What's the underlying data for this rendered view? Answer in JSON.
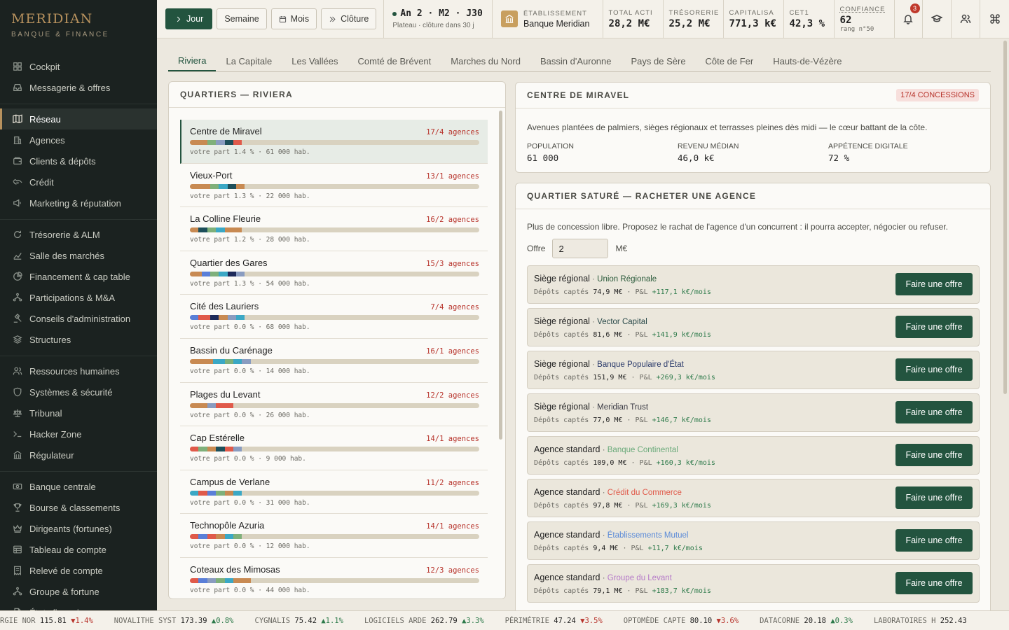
{
  "brand": {
    "name": "MERIDIAN",
    "sub": "BANQUE & FINANCE"
  },
  "nav_groups": [
    [
      {
        "label": "Cockpit",
        "icon": "grid-icon"
      },
      {
        "label": "Messagerie & offres",
        "icon": "inbox-icon"
      }
    ],
    [
      {
        "label": "Réseau",
        "icon": "map-icon",
        "active": true
      },
      {
        "label": "Agences",
        "icon": "building-icon"
      },
      {
        "label": "Clients & dépôts",
        "icon": "wallet-icon"
      },
      {
        "label": "Crédit",
        "icon": "handshake-icon"
      },
      {
        "label": "Marketing & réputation",
        "icon": "megaphone-icon"
      }
    ],
    [
      {
        "label": "Trésorerie & ALM",
        "icon": "refresh-icon"
      },
      {
        "label": "Salle des marchés",
        "icon": "chart-icon"
      },
      {
        "label": "Financement & cap table",
        "icon": "pie-icon"
      },
      {
        "label": "Participations & M&A",
        "icon": "network-icon"
      },
      {
        "label": "Conseils d'administration",
        "icon": "gavel-icon"
      },
      {
        "label": "Structures",
        "icon": "layers-icon"
      }
    ],
    [
      {
        "label": "Ressources humaines",
        "icon": "users-icon"
      },
      {
        "label": "Systèmes & sécurité",
        "icon": "shield-icon"
      },
      {
        "label": "Tribunal",
        "icon": "scale-icon"
      },
      {
        "label": "Hacker Zone",
        "icon": "terminal-icon"
      },
      {
        "label": "Régulateur",
        "icon": "bank-icon"
      }
    ],
    [
      {
        "label": "Banque centrale",
        "icon": "banknote-icon"
      },
      {
        "label": "Bourse & classements",
        "icon": "trophy-icon"
      },
      {
        "label": "Dirigeants (fortunes)",
        "icon": "crown-icon"
      },
      {
        "label": "Tableau de compte",
        "icon": "table-icon"
      },
      {
        "label": "Relevé de compte",
        "icon": "receipt-icon"
      },
      {
        "label": "Groupe & fortune",
        "icon": "network-icon"
      },
      {
        "label": "États financiers",
        "icon": "file-icon"
      }
    ]
  ],
  "topbar": {
    "buttons": [
      {
        "label": "Jour",
        "icon": "chevron-right-icon",
        "primary": true
      },
      {
        "label": "Semaine",
        "icon": ""
      },
      {
        "label": "Mois",
        "icon": "calendar-icon"
      },
      {
        "label": "Clôture",
        "icon": "double-chevron-icon"
      }
    ],
    "date": {
      "main": "An 2 · M2 · J30",
      "sub": "Plateau · clôture dans 30 j"
    },
    "etablissement": {
      "label": "ÉTABLISSEMENT",
      "value": "Banque Meridian"
    },
    "stats": [
      {
        "label": "TOTAL ACTI",
        "value": "28,2 M€",
        "sub": ""
      },
      {
        "label": "TRÉSORERIE",
        "value": "25,2 M€",
        "sub": ""
      },
      {
        "label": "CAPITALISA",
        "value": "771,3 k€",
        "sub": ""
      },
      {
        "label": "CET1",
        "value": "42,3 %",
        "sub": ""
      },
      {
        "label": "CONFIANCE",
        "value": "62",
        "sub": "rang n°50"
      }
    ],
    "notifications": "3"
  },
  "tabs": [
    "Riviera",
    "La Capitale",
    "Les Vallées",
    "Comté de Brévent",
    "Marches du Nord",
    "Bassin d'Auronne",
    "Pays de Sère",
    "Côte de Fer",
    "Hauts-de-Vézère"
  ],
  "quartiers": {
    "title": "QUARTIERS — RIVIERA",
    "items": [
      {
        "name": "Centre de Miravel",
        "agences": "17/4 agences",
        "meta": "votre part 1.4 % · 61 000 hab.",
        "bar": [
          [
            "#c88a52",
            6
          ],
          [
            "#7fb07a",
            3
          ],
          [
            "#8a9cc0",
            3
          ],
          [
            "#1d4f5a",
            3
          ],
          [
            "#e05a4a",
            3
          ]
        ]
      },
      {
        "name": "Vieux-Port",
        "agences": "13/1 agences",
        "meta": "votre part 1.3 % · 22 000 hab.",
        "bar": [
          [
            "#c88a52",
            7
          ],
          [
            "#7fb07a",
            3
          ],
          [
            "#3ba8c5",
            3
          ],
          [
            "#1d4f5a",
            3
          ],
          [
            "#c88a52",
            3
          ]
        ]
      },
      {
        "name": "La Colline Fleurie",
        "agences": "16/2 agences",
        "meta": "votre part 1.2 % · 28 000 hab.",
        "bar": [
          [
            "#c88a52",
            3
          ],
          [
            "#1d4f5a",
            3
          ],
          [
            "#7fb07a",
            3
          ],
          [
            "#3ba8c5",
            3
          ],
          [
            "#c88a52",
            6
          ]
        ]
      },
      {
        "name": "Quartier des Gares",
        "agences": "15/3 agences",
        "meta": "votre part 1.3 % · 54 000 hab.",
        "bar": [
          [
            "#c88a52",
            4
          ],
          [
            "#5a7fd8",
            3
          ],
          [
            "#7fb07a",
            3
          ],
          [
            "#3ba8c5",
            3
          ],
          [
            "#1d2a5a",
            3
          ],
          [
            "#8a9cc0",
            3
          ]
        ]
      },
      {
        "name": "Cité des Lauriers",
        "agences": "7/4 agences",
        "meta": "votre part 0.0 % · 68 000 hab.",
        "bar": [
          [
            "#5a7fd8",
            3
          ],
          [
            "#e05a4a",
            4
          ],
          [
            "#1d2a5a",
            3
          ],
          [
            "#c88a52",
            3
          ],
          [
            "#8a9cc0",
            3
          ],
          [
            "#3ba8c5",
            3
          ]
        ]
      },
      {
        "name": "Bassin du Carénage",
        "agences": "16/1 agences",
        "meta": "votre part 0.0 % · 14 000 hab.",
        "bar": [
          [
            "#c88a52",
            8
          ],
          [
            "#3ba8c5",
            4
          ],
          [
            "#7fb07a",
            3
          ],
          [
            "#3ba8c5",
            3
          ],
          [
            "#8a9cc0",
            3
          ]
        ]
      },
      {
        "name": "Plages du Levant",
        "agences": "12/2 agences",
        "meta": "votre part 0.0 % · 26 000 hab.",
        "bar": [
          [
            "#c88a52",
            3
          ],
          [
            "#c88a52",
            3
          ],
          [
            "#8a9cc0",
            3
          ],
          [
            "#e05a4a",
            3
          ],
          [
            "#e05a4a",
            3
          ]
        ]
      },
      {
        "name": "Cap Estérelle",
        "agences": "14/1 agences",
        "meta": "votre part 0.0 % · 9 000 hab.",
        "bar": [
          [
            "#e05a4a",
            3
          ],
          [
            "#7fb07a",
            3
          ],
          [
            "#c88a52",
            3
          ],
          [
            "#1d4f5a",
            3
          ],
          [
            "#e05a4a",
            3
          ],
          [
            "#8a9cc0",
            3
          ]
        ]
      },
      {
        "name": "Campus de Verlane",
        "agences": "11/2 agences",
        "meta": "votre part 0.0 % · 31 000 hab.",
        "bar": [
          [
            "#3ba8c5",
            3
          ],
          [
            "#e05a4a",
            3
          ],
          [
            "#5a7fd8",
            3
          ],
          [
            "#7fb07a",
            3
          ],
          [
            "#c88a52",
            3
          ],
          [
            "#3ba8c5",
            3
          ]
        ]
      },
      {
        "name": "Technopôle Azuria",
        "agences": "14/1 agences",
        "meta": "votre part 0.0 % · 12 000 hab.",
        "bar": [
          [
            "#e05a4a",
            3
          ],
          [
            "#5a7fd8",
            3
          ],
          [
            "#e05a4a",
            3
          ],
          [
            "#c88a52",
            3
          ],
          [
            "#3ba8c5",
            3
          ],
          [
            "#7fb07a",
            3
          ]
        ]
      },
      {
        "name": "Coteaux des Mimosas",
        "agences": "12/3 agences",
        "meta": "votre part 0.0 % · 44 000 hab.",
        "bar": [
          [
            "#e05a4a",
            3
          ],
          [
            "#5a7fd8",
            3
          ],
          [
            "#8a9cc0",
            3
          ],
          [
            "#7fb07a",
            3
          ],
          [
            "#3ba8c5",
            3
          ],
          [
            "#c88a52",
            6
          ]
        ]
      }
    ]
  },
  "detail": {
    "title": "CENTRE DE MIRAVEL",
    "badge": "17/4 CONCESSIONS",
    "description": "Avenues plantées de palmiers, sièges régionaux et terrasses pleines dès midi — le cœur battant de la côte.",
    "metrics": [
      {
        "label": "POPULATION",
        "value": "61 000"
      },
      {
        "label": "REVENU MÉDIAN",
        "value": "46,0 k€"
      },
      {
        "label": "APPÉTENCE DIGITALE",
        "value": "72 %"
      }
    ]
  },
  "offers": {
    "title": "QUARTIER SATURÉ — RACHETER UNE AGENCE",
    "intro": "Plus de concession libre. Proposez le rachat de l'agence d'un concurrent : il pourra accepter, négocier ou refuser.",
    "offer_label": "Offre",
    "offer_value": "2",
    "offer_unit": "M€",
    "button_label": "Faire une offre",
    "deposits_label": "Dépôts captés",
    "pl_label": "P&L",
    "cards": [
      {
        "type": "Siège régional",
        "owner": "Union Régionale",
        "color": "#2a5a3a",
        "deposits": "74,9 M€",
        "pl": "+117,1 k€/mois"
      },
      {
        "type": "Siège régional",
        "owner": "Vector Capital",
        "color": "#2a4a4a",
        "deposits": "81,6 M€",
        "pl": "+141,9 k€/mois"
      },
      {
        "type": "Siège régional",
        "owner": "Banque Populaire d'État",
        "color": "#2a3a6a",
        "deposits": "151,9 M€",
        "pl": "+269,3 k€/mois"
      },
      {
        "type": "Siège régional",
        "owner": "Meridian Trust",
        "color": "#3a3a44",
        "deposits": "77,0 M€",
        "pl": "+146,7 k€/mois"
      },
      {
        "type": "Agence standard",
        "owner": "Banque Continental",
        "color": "#6aaa7a",
        "deposits": "109,0 M€",
        "pl": "+160,3 k€/mois"
      },
      {
        "type": "Agence standard",
        "owner": "Crédit du Commerce",
        "color": "#e05a4a",
        "deposits": "97,8 M€",
        "pl": "+169,3 k€/mois"
      },
      {
        "type": "Agence standard",
        "owner": "Établissements Mutuel",
        "color": "#5a8ad8",
        "deposits": "9,4 M€",
        "pl": "+11,7 k€/mois"
      },
      {
        "type": "Agence standard",
        "owner": "Groupe du Levant",
        "color": "#b57ac8",
        "deposits": "79,1 M€",
        "pl": "+183,7 k€/mois"
      }
    ]
  },
  "ticker": [
    {
      "name": "RGIE NOR",
      "price": "115.81",
      "chg": "▼1.4%",
      "dir": "dn"
    },
    {
      "name": "NOVALITHE SYST",
      "price": "173.39",
      "chg": "▲0.8%",
      "dir": "up"
    },
    {
      "name": "CYGNALIS",
      "price": "75.42",
      "chg": "▲1.1%",
      "dir": "up"
    },
    {
      "name": "LOGICIELS ARDE",
      "price": "262.79",
      "chg": "▲3.3%",
      "dir": "up"
    },
    {
      "name": "PÉRIMÉTRIE",
      "price": "47.24",
      "chg": "▼3.5%",
      "dir": "dn"
    },
    {
      "name": "OPTOMÈDE CAPTE",
      "price": "80.10",
      "chg": "▼3.6%",
      "dir": "dn"
    },
    {
      "name": "DATACORNE",
      "price": "20.18",
      "chg": "▲0.3%",
      "dir": "up"
    },
    {
      "name": "LABORATOIRES H",
      "price": "252.43",
      "chg": "",
      "dir": "up"
    }
  ]
}
